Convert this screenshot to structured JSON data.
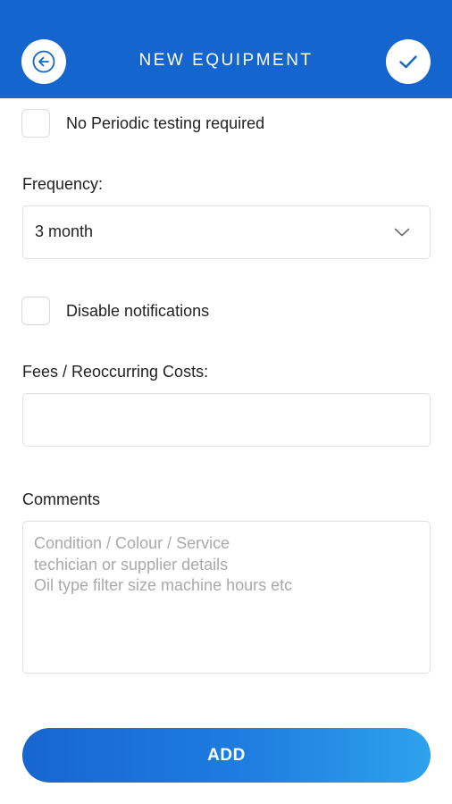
{
  "header": {
    "title": "NEW EQUIPMENT",
    "back_icon": "arrow-left-icon",
    "confirm_icon": "check-icon",
    "color": "#1565cf"
  },
  "form": {
    "no_periodic_testing_label": "No Periodic testing required",
    "frequency_label": "Frequency:",
    "frequency_value": "3 month",
    "disable_notifications_label": "Disable notifications",
    "fees_label": "Fees / Reoccurring Costs:",
    "fees_value": "",
    "comments_label": "Comments",
    "comments_placeholder": "Condition / Colour / Service\ntechician or supplier details\nOil type filter size machine hours etc"
  },
  "actions": {
    "add_label": "ADD"
  }
}
